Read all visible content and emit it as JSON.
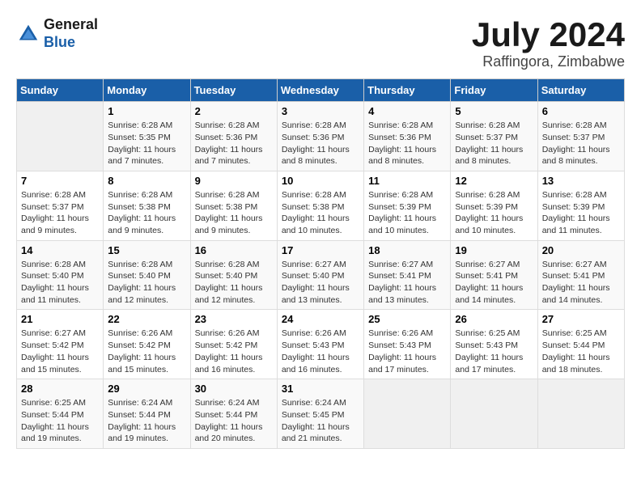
{
  "logo": {
    "line1": "General",
    "line2": "Blue"
  },
  "title": "July 2024",
  "location": "Raffingora, Zimbabwe",
  "days_of_week": [
    "Sunday",
    "Monday",
    "Tuesday",
    "Wednesday",
    "Thursday",
    "Friday",
    "Saturday"
  ],
  "weeks": [
    [
      {
        "day": "",
        "info": ""
      },
      {
        "day": "1",
        "info": "Sunrise: 6:28 AM\nSunset: 5:35 PM\nDaylight: 11 hours\nand 7 minutes."
      },
      {
        "day": "2",
        "info": "Sunrise: 6:28 AM\nSunset: 5:36 PM\nDaylight: 11 hours\nand 7 minutes."
      },
      {
        "day": "3",
        "info": "Sunrise: 6:28 AM\nSunset: 5:36 PM\nDaylight: 11 hours\nand 8 minutes."
      },
      {
        "day": "4",
        "info": "Sunrise: 6:28 AM\nSunset: 5:36 PM\nDaylight: 11 hours\nand 8 minutes."
      },
      {
        "day": "5",
        "info": "Sunrise: 6:28 AM\nSunset: 5:37 PM\nDaylight: 11 hours\nand 8 minutes."
      },
      {
        "day": "6",
        "info": "Sunrise: 6:28 AM\nSunset: 5:37 PM\nDaylight: 11 hours\nand 8 minutes."
      }
    ],
    [
      {
        "day": "7",
        "info": "Sunrise: 6:28 AM\nSunset: 5:37 PM\nDaylight: 11 hours\nand 9 minutes."
      },
      {
        "day": "8",
        "info": "Sunrise: 6:28 AM\nSunset: 5:38 PM\nDaylight: 11 hours\nand 9 minutes."
      },
      {
        "day": "9",
        "info": "Sunrise: 6:28 AM\nSunset: 5:38 PM\nDaylight: 11 hours\nand 9 minutes."
      },
      {
        "day": "10",
        "info": "Sunrise: 6:28 AM\nSunset: 5:38 PM\nDaylight: 11 hours\nand 10 minutes."
      },
      {
        "day": "11",
        "info": "Sunrise: 6:28 AM\nSunset: 5:39 PM\nDaylight: 11 hours\nand 10 minutes."
      },
      {
        "day": "12",
        "info": "Sunrise: 6:28 AM\nSunset: 5:39 PM\nDaylight: 11 hours\nand 10 minutes."
      },
      {
        "day": "13",
        "info": "Sunrise: 6:28 AM\nSunset: 5:39 PM\nDaylight: 11 hours\nand 11 minutes."
      }
    ],
    [
      {
        "day": "14",
        "info": "Sunrise: 6:28 AM\nSunset: 5:40 PM\nDaylight: 11 hours\nand 11 minutes."
      },
      {
        "day": "15",
        "info": "Sunrise: 6:28 AM\nSunset: 5:40 PM\nDaylight: 11 hours\nand 12 minutes."
      },
      {
        "day": "16",
        "info": "Sunrise: 6:28 AM\nSunset: 5:40 PM\nDaylight: 11 hours\nand 12 minutes."
      },
      {
        "day": "17",
        "info": "Sunrise: 6:27 AM\nSunset: 5:40 PM\nDaylight: 11 hours\nand 13 minutes."
      },
      {
        "day": "18",
        "info": "Sunrise: 6:27 AM\nSunset: 5:41 PM\nDaylight: 11 hours\nand 13 minutes."
      },
      {
        "day": "19",
        "info": "Sunrise: 6:27 AM\nSunset: 5:41 PM\nDaylight: 11 hours\nand 14 minutes."
      },
      {
        "day": "20",
        "info": "Sunrise: 6:27 AM\nSunset: 5:41 PM\nDaylight: 11 hours\nand 14 minutes."
      }
    ],
    [
      {
        "day": "21",
        "info": "Sunrise: 6:27 AM\nSunset: 5:42 PM\nDaylight: 11 hours\nand 15 minutes."
      },
      {
        "day": "22",
        "info": "Sunrise: 6:26 AM\nSunset: 5:42 PM\nDaylight: 11 hours\nand 15 minutes."
      },
      {
        "day": "23",
        "info": "Sunrise: 6:26 AM\nSunset: 5:42 PM\nDaylight: 11 hours\nand 16 minutes."
      },
      {
        "day": "24",
        "info": "Sunrise: 6:26 AM\nSunset: 5:43 PM\nDaylight: 11 hours\nand 16 minutes."
      },
      {
        "day": "25",
        "info": "Sunrise: 6:26 AM\nSunset: 5:43 PM\nDaylight: 11 hours\nand 17 minutes."
      },
      {
        "day": "26",
        "info": "Sunrise: 6:25 AM\nSunset: 5:43 PM\nDaylight: 11 hours\nand 17 minutes."
      },
      {
        "day": "27",
        "info": "Sunrise: 6:25 AM\nSunset: 5:44 PM\nDaylight: 11 hours\nand 18 minutes."
      }
    ],
    [
      {
        "day": "28",
        "info": "Sunrise: 6:25 AM\nSunset: 5:44 PM\nDaylight: 11 hours\nand 19 minutes."
      },
      {
        "day": "29",
        "info": "Sunrise: 6:24 AM\nSunset: 5:44 PM\nDaylight: 11 hours\nand 19 minutes."
      },
      {
        "day": "30",
        "info": "Sunrise: 6:24 AM\nSunset: 5:44 PM\nDaylight: 11 hours\nand 20 minutes."
      },
      {
        "day": "31",
        "info": "Sunrise: 6:24 AM\nSunset: 5:45 PM\nDaylight: 11 hours\nand 21 minutes."
      },
      {
        "day": "",
        "info": ""
      },
      {
        "day": "",
        "info": ""
      },
      {
        "day": "",
        "info": ""
      }
    ]
  ]
}
